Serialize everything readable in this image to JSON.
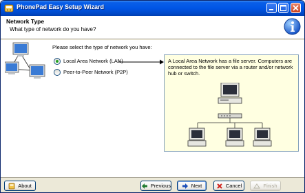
{
  "window": {
    "title": "PhonePad Easy Setup Wizard",
    "icons": {
      "app": "app-icon",
      "minimize": "minimize-icon",
      "maximize": "maximize-icon",
      "close": "close-icon"
    }
  },
  "header": {
    "title": "Network Type",
    "subtitle": "What type of network do you have?",
    "icon": "info-icon"
  },
  "main": {
    "prompt": "Please select the type of network you have:",
    "options": [
      {
        "label": "Local Area Network (LAN)",
        "selected": true
      },
      {
        "label": "Peer-to-Peer Network (P2P)",
        "selected": false
      }
    ],
    "description": "A Local Area Network has a file server.  Computers are connected to the file server via a router and/or network hub or switch.",
    "diagram_icon": "lan-diagram-icon",
    "network_icon": "network-computers-icon"
  },
  "footer": {
    "about_label": "About",
    "previous_label": "Previous",
    "next_label": "Next",
    "cancel_label": "Cancel",
    "finish_label": "Finish",
    "finish_enabled": false
  },
  "colors": {
    "titlebar": "#0055e5",
    "description_bg": "#ffffe1",
    "radio_selected": "#21a121",
    "button_border": "#003c74"
  }
}
